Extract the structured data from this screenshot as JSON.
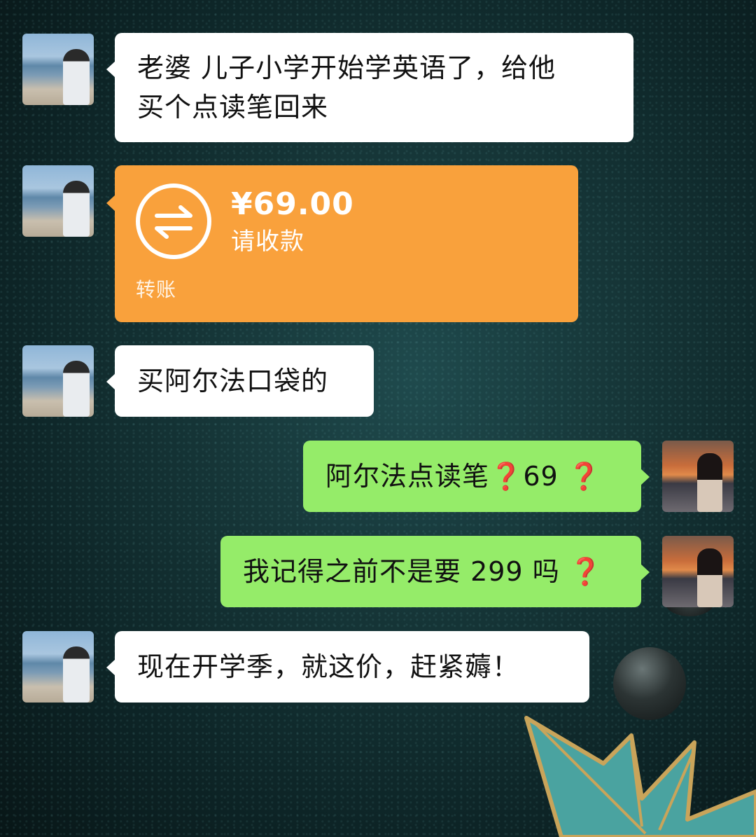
{
  "chat": {
    "messages": [
      {
        "side": "left",
        "text_line1": "老婆 儿子小学开始学英语了，给他",
        "text_line2": "买个点读笔回来"
      },
      {
        "side": "left",
        "type": "transfer",
        "amount": "¥69.00",
        "status": "请收款",
        "label": "转账"
      },
      {
        "side": "left",
        "text": "买阿尔法口袋的"
      },
      {
        "side": "right",
        "text_before": "阿尔法点读笔",
        "mark1": "❓",
        "text_mid": "69",
        "mark2": "❓"
      },
      {
        "side": "right",
        "text_before": "我记得之前不是要 299 吗",
        "mark1": "❓"
      },
      {
        "side": "left",
        "text": "现在开学季，就这价，赶紧薅！"
      }
    ]
  },
  "colors": {
    "bubble_white": "#ffffff",
    "bubble_green": "#95ec69",
    "transfer_orange": "#f9a13c",
    "question_mark": "#e0242c"
  },
  "icons": {
    "transfer": "transfer-arrows-icon",
    "left_avatar": "beach-person-avatar",
    "right_avatar": "sunset-girl-avatar"
  }
}
